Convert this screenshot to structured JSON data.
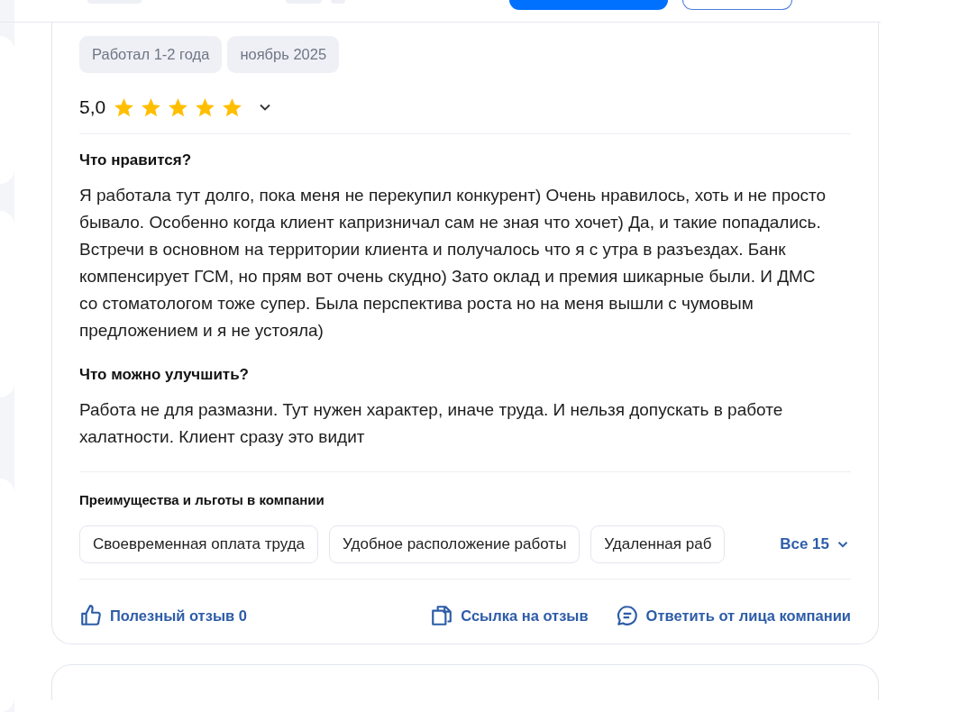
{
  "review": {
    "tags": [
      "Работал 1-2 года",
      "ноябрь 2025"
    ],
    "rating": "5,0",
    "stars": 5,
    "sections": [
      {
        "title": "Что нравится?",
        "text": "Я работала тут долго, пока меня не перекупил конкурент) Очень нравилось, хоть и не просто бывало. Особенно когда клиент капризничал сам не зная что хочет) Да, и такие попадались. Встречи в основном на территории клиента и получалось что я с утра в разъездах. Банк компенсирует ГСМ, но прям вот очень скудно) Зато оклад и премия шикарные были. И ДМС со стоматологом тоже супер. Была перспектива роста но на меня вышли с чумовым предложением и я не устояла)"
      },
      {
        "title": "Что можно улучшить?",
        "text": "Работа не для размазни. Тут нужен характер, иначе труда. И нельзя допускать в работе халатности. Клиент сразу это видит"
      }
    ],
    "benefits_title": "Преимущества и льготы в компании",
    "benefits": [
      "Своевременная оплата труда",
      "Удобное расположение работы",
      "Удаленная раб"
    ],
    "benefits_more": "Все 15",
    "actions": [
      {
        "kind": "like",
        "label": "Полезный отзыв 0"
      },
      {
        "kind": "link",
        "label": "Ссылка на отзыв"
      },
      {
        "kind": "reply",
        "label": "Ответить от лица компании"
      }
    ]
  }
}
